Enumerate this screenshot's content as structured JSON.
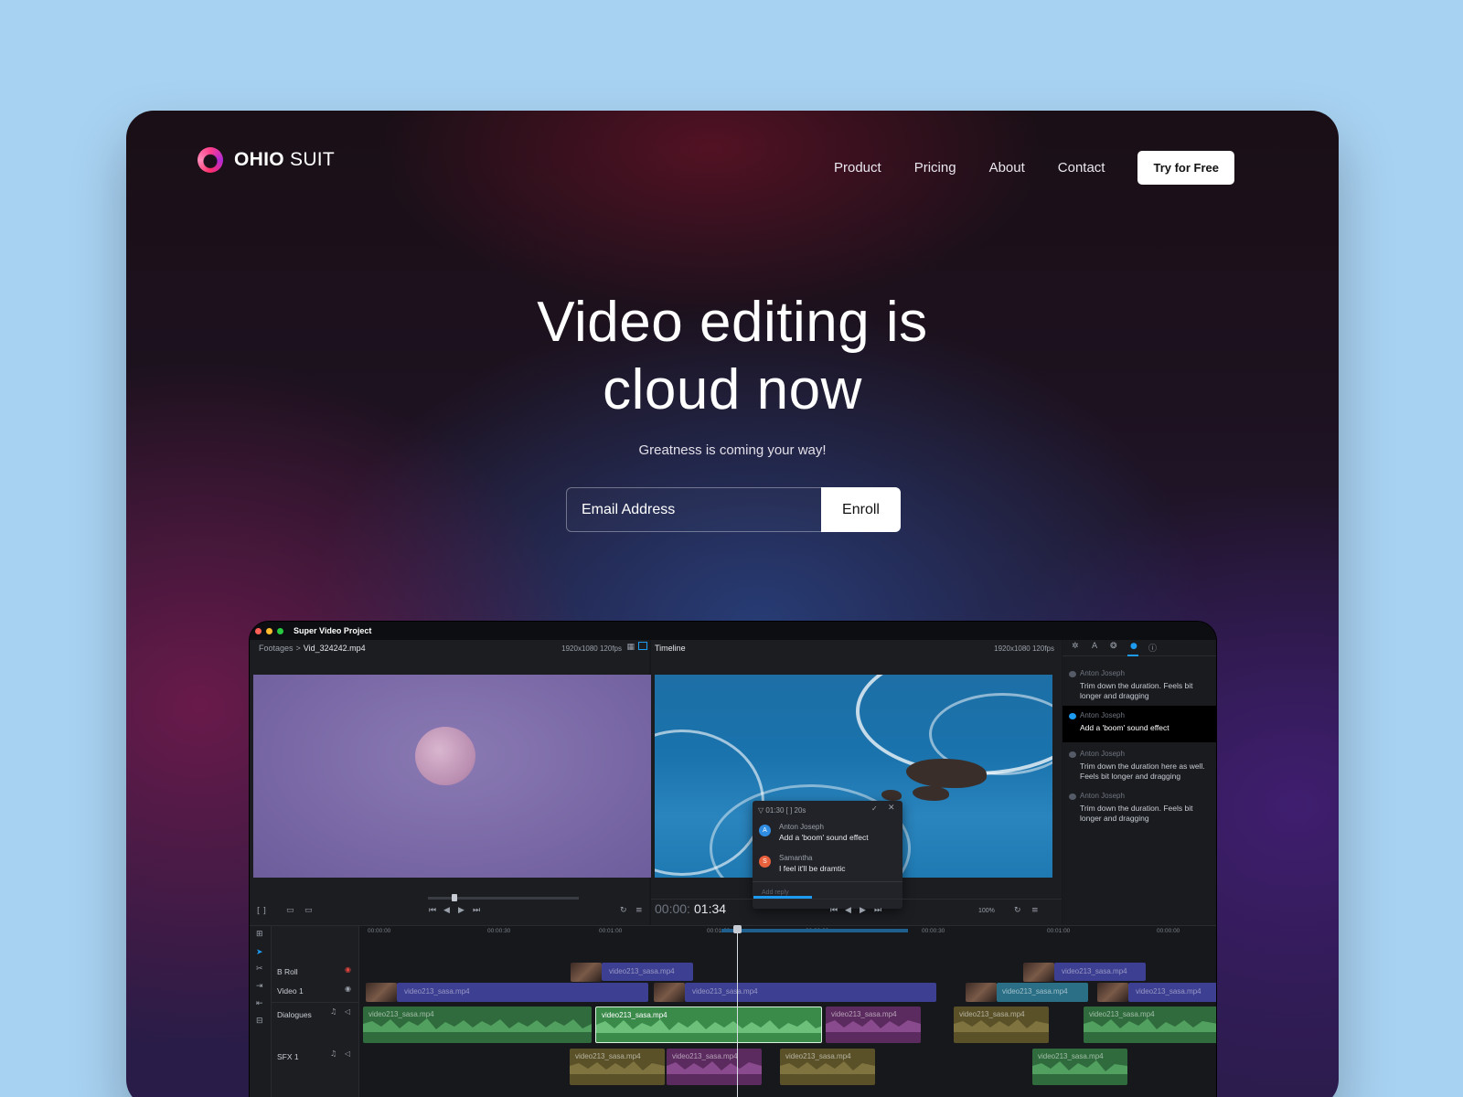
{
  "brand": {
    "bold": "OHIO",
    "light": "SUIT"
  },
  "nav": {
    "items": [
      "Product",
      "Pricing",
      "About",
      "Contact"
    ],
    "cta": "Try for Free"
  },
  "hero": {
    "title_line1": "Video editing is",
    "title_line2": "cloud now",
    "subtitle": "Greatness is coming your way!",
    "email_placeholder": "Email Address",
    "enroll": "Enroll"
  },
  "app": {
    "window_title": "Super Video Project",
    "footages": {
      "crumb_root": "Footages",
      "crumb_sep": ">",
      "file": "Vid_324242.mp4",
      "meta": "1920x1080  120fps"
    },
    "timeline_panel": {
      "title": "Timeline",
      "meta": "1920x1080  120fps",
      "timecode_dim": "00:00:",
      "timecode": "01:34",
      "zoom": "100%"
    },
    "popup": {
      "header": "▽ 01:30  [ ] 20s",
      "comments": [
        {
          "initial": "A",
          "name": "Anton Joseph",
          "text": "Add a 'boom' sound effect"
        },
        {
          "initial": "S",
          "name": "Samantha",
          "text": "I feel it'll be dramtic"
        }
      ],
      "reply_placeholder": "Add reply"
    },
    "sidebar_comments": [
      {
        "name": "Anton Joseph",
        "text": "Trim down the duration. Feels bit longer and dragging"
      },
      {
        "name": "Anton Joseph",
        "text": "Add a 'boom' sound effect"
      },
      {
        "name": "Anton Joseph",
        "text": "Trim down the duration here as well. Feels bit longer and dragging"
      },
      {
        "name": "Anton Joseph",
        "text": "Trim down the duration. Feels bit longer and dragging"
      }
    ],
    "ruler_ticks": [
      "00:00:00",
      "00:00:30",
      "00:01:00",
      "00:01:30",
      "00:00:00",
      "00:00:30",
      "00:01:00",
      "00:00:00"
    ],
    "tracks": [
      "B Roll",
      "Video 1",
      "Dialogues",
      "SFX 1"
    ],
    "clip_name": "video213_sasa.mp4",
    "colors": {
      "accent": "#1d9bf0",
      "video_clip": "#3d3f92",
      "audio_green": "#2f6b3c",
      "audio_purple": "#5b2a5e",
      "audio_olive": "#5a5128",
      "popup_avatar_a": "#2f8de4",
      "popup_avatar_s": "#e8603c"
    }
  }
}
